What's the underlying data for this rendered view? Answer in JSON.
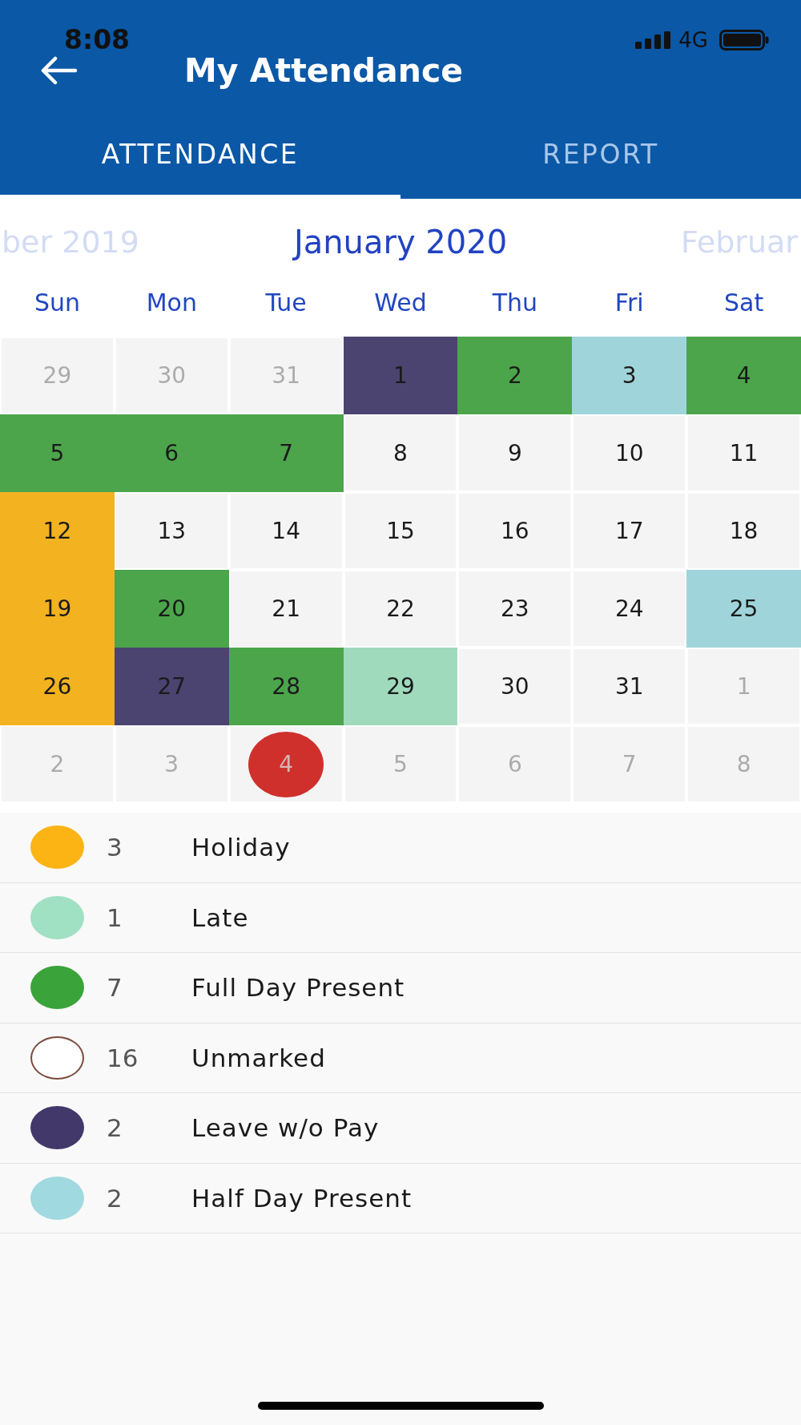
{
  "status_bar": {
    "time": "8:08",
    "network": "4G"
  },
  "header": {
    "title": "My Attendance"
  },
  "tabs": [
    {
      "label": "ATTENDANCE",
      "selected": true
    },
    {
      "label": "REPORT",
      "selected": false
    }
  ],
  "month_nav": {
    "previous": "ber 2019",
    "current": "January 2020",
    "next": "Februar"
  },
  "weekdays": [
    "Sun",
    "Mon",
    "Tue",
    "Wed",
    "Thu",
    "Fri",
    "Sat"
  ],
  "calendar": {
    "weeks": [
      {
        "days": [
          {
            "day": "29",
            "other_month": true,
            "today": false
          },
          {
            "day": "30",
            "other_month": true,
            "today": false
          },
          {
            "day": "31",
            "other_month": true,
            "today": false
          },
          {
            "day": "1",
            "other_month": false,
            "today": false,
            "color": "#4b4470"
          },
          {
            "day": "2",
            "other_month": false,
            "today": false,
            "color": "#4ca54b"
          },
          {
            "day": "3",
            "other_month": false,
            "today": false,
            "color": "#9fd5da"
          },
          {
            "day": "4",
            "other_month": false,
            "today": false,
            "color": "#4ca54b"
          }
        ]
      },
      {
        "days": [
          {
            "day": "5",
            "other_month": false,
            "today": false,
            "color": "#4ca54b"
          },
          {
            "day": "6",
            "other_month": false,
            "today": false,
            "color": "#4ca54b"
          },
          {
            "day": "7",
            "other_month": false,
            "today": false,
            "color": "#4ca54b"
          },
          {
            "day": "8",
            "other_month": false,
            "today": false
          },
          {
            "day": "9",
            "other_month": false,
            "today": false
          },
          {
            "day": "10",
            "other_month": false,
            "today": false
          },
          {
            "day": "11",
            "other_month": false,
            "today": false
          }
        ]
      },
      {
        "days": [
          {
            "day": "12",
            "other_month": false,
            "today": false,
            "color": "#f3b21f"
          },
          {
            "day": "13",
            "other_month": false,
            "today": false
          },
          {
            "day": "14",
            "other_month": false,
            "today": false
          },
          {
            "day": "15",
            "other_month": false,
            "today": false
          },
          {
            "day": "16",
            "other_month": false,
            "today": false
          },
          {
            "day": "17",
            "other_month": false,
            "today": false
          },
          {
            "day": "18",
            "other_month": false,
            "today": false
          }
        ]
      },
      {
        "days": [
          {
            "day": "19",
            "other_month": false,
            "today": false,
            "color": "#f3b21f"
          },
          {
            "day": "20",
            "other_month": false,
            "today": false,
            "color": "#4ca54b"
          },
          {
            "day": "21",
            "other_month": false,
            "today": false
          },
          {
            "day": "22",
            "other_month": false,
            "today": false
          },
          {
            "day": "23",
            "other_month": false,
            "today": false
          },
          {
            "day": "24",
            "other_month": false,
            "today": false
          },
          {
            "day": "25",
            "other_month": false,
            "today": false,
            "color": "#9fd5da"
          }
        ]
      },
      {
        "days": [
          {
            "day": "26",
            "other_month": false,
            "today": false,
            "color": "#f3b21f"
          },
          {
            "day": "27",
            "other_month": false,
            "today": false,
            "color": "#4b4470"
          },
          {
            "day": "28",
            "other_month": false,
            "today": false,
            "color": "#4ca54b"
          },
          {
            "day": "29",
            "other_month": false,
            "today": false,
            "color": "#9fdabd"
          },
          {
            "day": "30",
            "other_month": false,
            "today": false
          },
          {
            "day": "31",
            "other_month": false,
            "today": false
          },
          {
            "day": "1",
            "other_month": true,
            "today": false
          }
        ]
      },
      {
        "days": [
          {
            "day": "2",
            "other_month": true,
            "today": false
          },
          {
            "day": "3",
            "other_month": true,
            "today": false
          },
          {
            "day": "4",
            "other_month": true,
            "today": true
          },
          {
            "day": "5",
            "other_month": true,
            "today": false
          },
          {
            "day": "6",
            "other_month": true,
            "today": false
          },
          {
            "day": "7",
            "other_month": true,
            "today": false
          },
          {
            "day": "8",
            "other_month": true,
            "today": false
          }
        ]
      }
    ]
  },
  "legend": [
    {
      "kind": "filled",
      "color": "#fcb415",
      "count": "3",
      "label": "Holiday"
    },
    {
      "kind": "filled",
      "color": "#a0e0c3",
      "count": "1",
      "label": "Late"
    },
    {
      "kind": "filled",
      "color": "#3aa33a",
      "count": "7",
      "label": "Full Day Present"
    },
    {
      "kind": "outline",
      "color": "#ffffff",
      "count": "16",
      "label": "Unmarked"
    },
    {
      "kind": "filled",
      "color": "#42386a",
      "count": "2",
      "label": "Leave w/o Pay"
    },
    {
      "kind": "filled",
      "color": "#a0d9e0",
      "count": "2",
      "label": "Half Day Present"
    }
  ]
}
